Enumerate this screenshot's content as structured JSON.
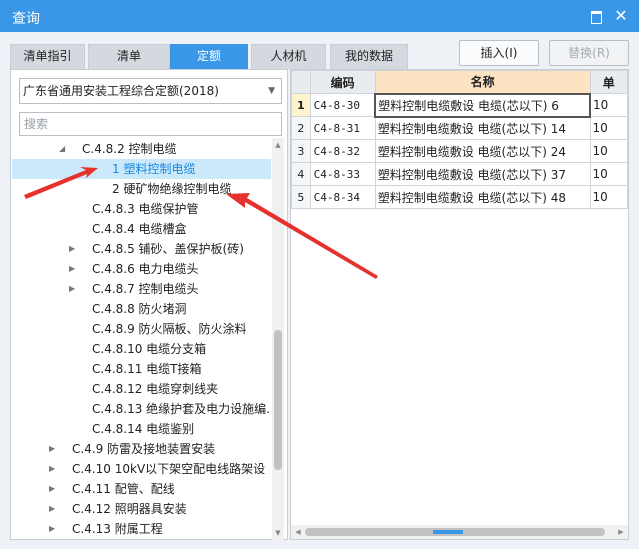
{
  "window": {
    "title": "查询",
    "maximize_icon": "maximize-icon",
    "close_label": "✕"
  },
  "tabs": [
    {
      "label": "清单指引",
      "active": false
    },
    {
      "label": "清单",
      "active": false
    },
    {
      "label": "定额",
      "active": true
    },
    {
      "label": "人材机",
      "active": false
    },
    {
      "label": "我的数据",
      "active": false
    }
  ],
  "toolbar": {
    "insert_label": "插入(I)",
    "replace_label": "替换(R)"
  },
  "left": {
    "quota_select": "广东省通用安装工程综合定额(2018)",
    "search_placeholder": "搜索"
  },
  "tree": [
    {
      "label": "C.4.8.2 控制电缆",
      "arrow": "◢"
    },
    {
      "label": "1 塑料控制电缆",
      "selected": true
    },
    {
      "label": "2 硬矿物绝缘控制电缆"
    },
    {
      "label": "C.4.8.3 电缆保护管"
    },
    {
      "label": "C.4.8.4 电缆槽盒"
    },
    {
      "label": "C.4.8.5 铺砂、盖保护板(砖)",
      "arrow": "▶"
    },
    {
      "label": "C.4.8.6 电力电缆头",
      "arrow": "▶"
    },
    {
      "label": "C.4.8.7 控制电缆头",
      "arrow": "▶"
    },
    {
      "label": "C.4.8.8 防火堵洞"
    },
    {
      "label": "C.4.8.9 防火隔板、防火涂料"
    },
    {
      "label": "C.4.8.10 电缆分支箱"
    },
    {
      "label": "C.4.8.11 电缆T接箱"
    },
    {
      "label": "C.4.8.12 电缆穿刺线夹"
    },
    {
      "label": "C.4.8.13 绝缘护套及电力设施编..."
    },
    {
      "label": "C.4.8.14 电缆鉴别"
    },
    {
      "label": "C.4.9 防雷及接地装置安装",
      "arrow": "▶"
    },
    {
      "label": "C.4.10 10kV以下架空配电线路架设",
      "arrow": "▶"
    },
    {
      "label": "C.4.11 配管、配线",
      "arrow": "▶"
    },
    {
      "label": "C.4.12 照明器具安装",
      "arrow": "▶"
    },
    {
      "label": "C.4.13 附属工程",
      "arrow": "▶"
    }
  ],
  "grid": {
    "headers": {
      "code": "编码",
      "name": "名称",
      "unit": "单"
    },
    "rows": [
      {
        "idx": "1",
        "code": "C4-8-30",
        "name": "塑料控制电缆敷设 电缆(芯以下) 6",
        "unit": "10"
      },
      {
        "idx": "2",
        "code": "C4-8-31",
        "name": "塑料控制电缆敷设 电缆(芯以下) 14",
        "unit": "10"
      },
      {
        "idx": "3",
        "code": "C4-8-32",
        "name": "塑料控制电缆敷设 电缆(芯以下) 24",
        "unit": "10"
      },
      {
        "idx": "4",
        "code": "C4-8-33",
        "name": "塑料控制电缆敷设 电缆(芯以下) 37",
        "unit": "10"
      },
      {
        "idx": "5",
        "code": "C4-8-34",
        "name": "塑料控制电缆敷设 电缆(芯以下) 48",
        "unit": "10"
      }
    ]
  },
  "colors": {
    "accent": "#3a97e8",
    "annotation_arrow": "#e5322d",
    "selected_bg": "#cce8fb",
    "header_name_bg": "#fbe3c4"
  }
}
